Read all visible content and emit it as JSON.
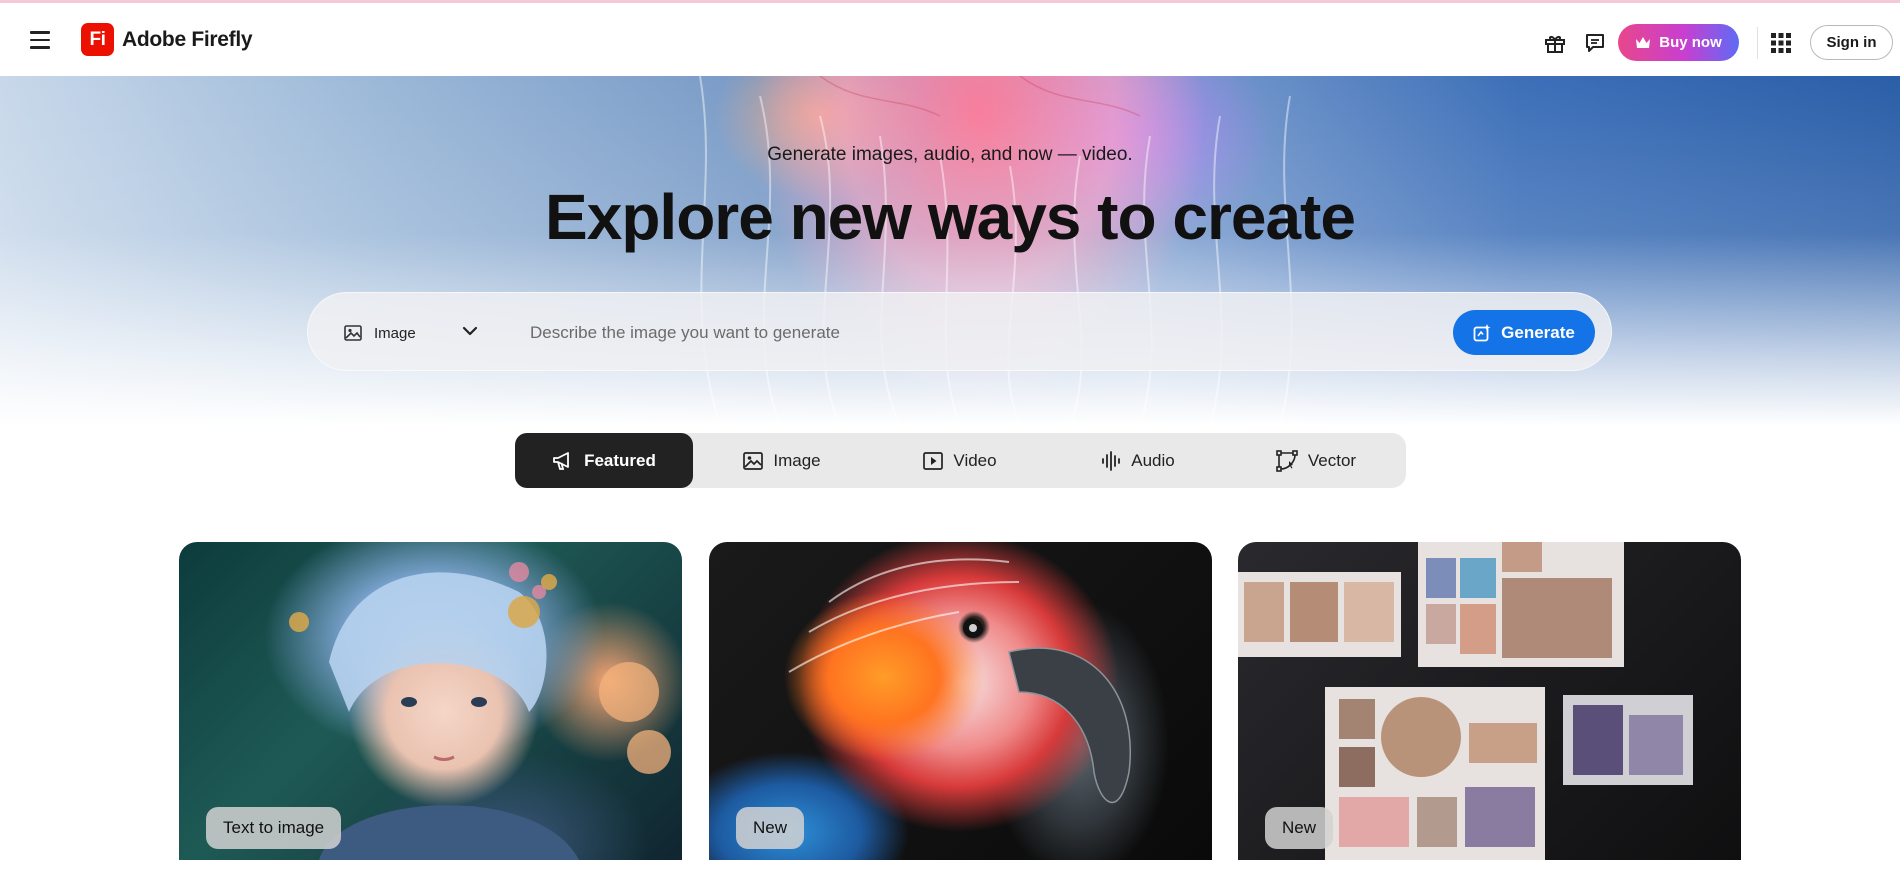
{
  "header": {
    "brand_logo_text": "Fi",
    "brand_name": "Adobe Firefly",
    "buy_now_label": "Buy now",
    "sign_in_label": "Sign in"
  },
  "hero": {
    "subtitle": "Generate images, audio, and now — video.",
    "title": "Explore new ways to create",
    "prompt": {
      "type_selected": "Image",
      "placeholder": "Describe the image you want to generate",
      "value": "",
      "generate_label": "Generate"
    }
  },
  "tabs": [
    {
      "label": "Featured",
      "icon": "megaphone-icon",
      "active": true
    },
    {
      "label": "Image",
      "icon": "image-icon",
      "active": false
    },
    {
      "label": "Video",
      "icon": "video-icon",
      "active": false
    },
    {
      "label": "Audio",
      "icon": "audio-wave-icon",
      "active": false
    },
    {
      "label": "Vector",
      "icon": "vector-icon",
      "active": false
    }
  ],
  "cards": [
    {
      "badge": "Text to image"
    },
    {
      "badge": "New"
    },
    {
      "badge": "New"
    }
  ],
  "colors": {
    "brand_red": "#eb1000",
    "generate_blue": "#1473e6",
    "active_tab": "#222222"
  }
}
